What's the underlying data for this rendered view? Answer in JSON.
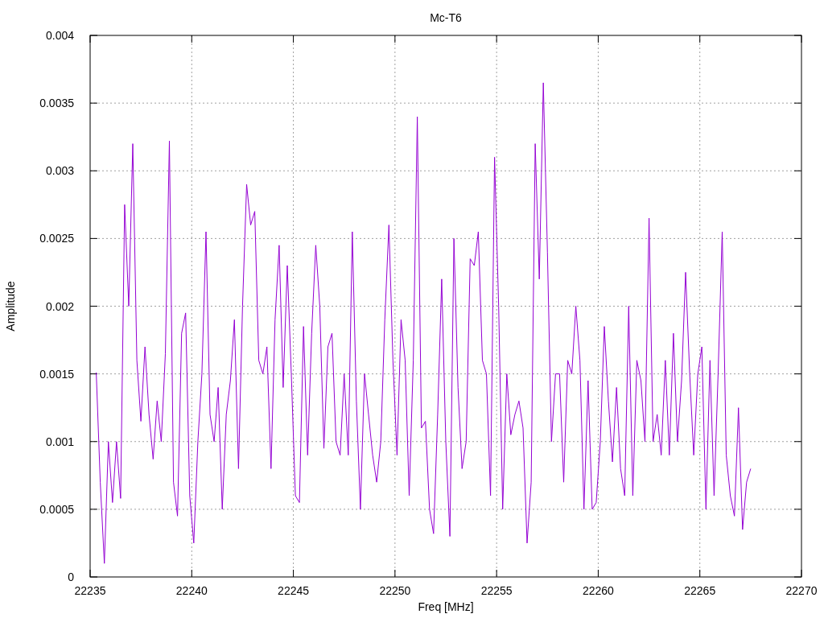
{
  "plot": {
    "chart_data": {
      "type": "line",
      "title": "Mc-T6",
      "xlabel": "Freq [MHz]",
      "ylabel": "Amplitude",
      "grid": true,
      "xlim": [
        22235,
        22270
      ],
      "ylim": [
        0,
        0.004
      ],
      "xticks": [
        22235,
        22240,
        22245,
        22250,
        22255,
        22260,
        22265,
        22270
      ],
      "yticks": [
        {
          "value": 0,
          "label": "0"
        },
        {
          "value": 0.0005,
          "label": "0.0005"
        },
        {
          "value": 0.001,
          "label": "0.001"
        },
        {
          "value": 0.0015,
          "label": "0.0015"
        },
        {
          "value": 0.002,
          "label": "0.002"
        },
        {
          "value": 0.0025,
          "label": "0.0025"
        },
        {
          "value": 0.003,
          "label": "0.003"
        },
        {
          "value": 0.0035,
          "label": "0.0035"
        },
        {
          "value": 0.004,
          "label": "0.004"
        }
      ],
      "x": [
        22235.3,
        22235.5,
        22235.7,
        22235.9,
        22236.1,
        22236.3,
        22236.5,
        22236.7,
        22236.9,
        22237.1,
        22237.3,
        22237.5,
        22237.7,
        22237.9,
        22238.1,
        22238.3,
        22238.5,
        22238.7,
        22238.9,
        22239.1,
        22239.3,
        22239.5,
        22239.7,
        22239.9,
        22240.1,
        22240.3,
        22240.5,
        22240.7,
        22240.9,
        22241.1,
        22241.3,
        22241.5,
        22241.7,
        22241.9,
        22242.1,
        22242.3,
        22242.5,
        22242.7,
        22242.9,
        22243.1,
        22243.3,
        22243.5,
        22243.7,
        22243.9,
        22244.1,
        22244.3,
        22244.5,
        22244.7,
        22244.9,
        22245.1,
        22245.3,
        22245.5,
        22245.7,
        22245.9,
        22246.1,
        22246.3,
        22246.5,
        22246.7,
        22246.9,
        22247.1,
        22247.3,
        22247.5,
        22247.7,
        22247.9,
        22248.1,
        22248.3,
        22248.5,
        22248.7,
        22248.9,
        22249.1,
        22249.3,
        22249.5,
        22249.7,
        22249.9,
        22250.1,
        22250.3,
        22250.5,
        22250.7,
        22250.9,
        22251.1,
        22251.3,
        22251.5,
        22251.7,
        22251.9,
        22252.1,
        22252.3,
        22252.5,
        22252.7,
        22252.9,
        22253.1,
        22253.3,
        22253.5,
        22253.7,
        22253.9,
        22254.1,
        22254.3,
        22254.5,
        22254.7,
        22254.9,
        22255.1,
        22255.3,
        22255.5,
        22255.7,
        22255.9,
        22256.1,
        22256.3,
        22256.5,
        22256.7,
        22256.9,
        22257.1,
        22257.3,
        22257.5,
        22257.7,
        22257.9,
        22258.1,
        22258.3,
        22258.5,
        22258.7,
        22258.9,
        22259.1,
        22259.3,
        22259.5,
        22259.7,
        22259.9,
        22260.1,
        22260.3,
        22260.5,
        22260.7,
        22260.9,
        22261.1,
        22261.3,
        22261.5,
        22261.7,
        22261.9,
        22262.1,
        22262.3,
        22262.5,
        22262.7,
        22262.9,
        22263.1,
        22263.3,
        22263.5,
        22263.7,
        22263.9,
        22264.1,
        22264.3,
        22264.5,
        22264.7,
        22264.9,
        22265.1,
        22265.3,
        22265.5,
        22265.7,
        22265.9,
        22266.1,
        22266.3,
        22266.5,
        22266.7,
        22266.9,
        22267.1,
        22267.3,
        22267.5
      ],
      "series": [
        {
          "color": "#9400d3",
          "values": [
            0.00151,
            0.0007,
            0.0001,
            0.001,
            0.00055,
            0.001,
            0.00058,
            0.00275,
            0.002,
            0.0032,
            0.0016,
            0.00115,
            0.0017,
            0.0012,
            0.00087,
            0.0013,
            0.001,
            0.00165,
            0.00322,
            0.0007,
            0.00045,
            0.0018,
            0.00195,
            0.0006,
            0.00025,
            0.001,
            0.0015,
            0.00255,
            0.0012,
            0.001,
            0.0014,
            0.0005,
            0.0012,
            0.00145,
            0.0019,
            0.0008,
            0.002,
            0.0029,
            0.0026,
            0.0027,
            0.0016,
            0.0015,
            0.0017,
            0.0008,
            0.0019,
            0.00245,
            0.0014,
            0.0023,
            0.0015,
            0.0006,
            0.00055,
            0.00185,
            0.0009,
            0.0018,
            0.00245,
            0.002,
            0.00095,
            0.0017,
            0.0018,
            0.001,
            0.0009,
            0.0015,
            0.0009,
            0.00255,
            0.0013,
            0.0005,
            0.0015,
            0.0012,
            0.0009,
            0.0007,
            0.001,
            0.0019,
            0.0026,
            0.0016,
            0.0009,
            0.0019,
            0.0016,
            0.0006,
            0.0016,
            0.0034,
            0.0011,
            0.00115,
            0.0005,
            0.00032,
            0.0012,
            0.0022,
            0.001,
            0.0003,
            0.0025,
            0.0014,
            0.0008,
            0.001,
            0.00235,
            0.0023,
            0.00255,
            0.0016,
            0.0015,
            0.0006,
            0.0031,
            0.002,
            0.0005,
            0.0015,
            0.00105,
            0.0012,
            0.0013,
            0.0011,
            0.00025,
            0.0007,
            0.0032,
            0.0022,
            0.00365,
            0.0024,
            0.001,
            0.0015,
            0.0015,
            0.0007,
            0.0016,
            0.0015,
            0.002,
            0.0016,
            0.0005,
            0.00145,
            0.0005,
            0.00055,
            0.001,
            0.00185,
            0.0013,
            0.00085,
            0.0014,
            0.0008,
            0.0006,
            0.002,
            0.0006,
            0.0016,
            0.00145,
            0.001,
            0.00265,
            0.001,
            0.0012,
            0.0009,
            0.0016,
            0.0009,
            0.0018,
            0.001,
            0.00145,
            0.00225,
            0.0015,
            0.0009,
            0.0015,
            0.0017,
            0.0005,
            0.0016,
            0.0006,
            0.0015,
            0.00255,
            0.0009,
            0.0006,
            0.00045,
            0.00125,
            0.00035,
            0.0007,
            0.0008
          ]
        }
      ]
    }
  }
}
